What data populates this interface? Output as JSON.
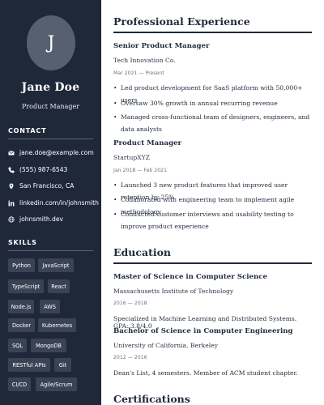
{
  "profile": {
    "initial": "J",
    "name": "Jane Doe",
    "role": "Product Manager"
  },
  "contact": {
    "title": "CONTACT",
    "items": [
      {
        "icon": "envelope-icon",
        "text": "jane.doe@example.com"
      },
      {
        "icon": "phone-icon",
        "text": "(555) 987-6543"
      },
      {
        "icon": "map-pin-icon",
        "text": "San Francisco, CA"
      },
      {
        "icon": "linkedin-icon",
        "text": "linkedin.com/in/johnsmith"
      },
      {
        "icon": "globe-icon",
        "text": "johnsmith.dev"
      }
    ]
  },
  "skills": {
    "title": "SKILLS",
    "items": [
      "Python",
      "JavaScript",
      "TypeScript",
      "React",
      "Node.js",
      "AWS",
      "Docker",
      "Kubernetes",
      "SQL",
      "MongoDB",
      "RESTful APIs",
      "Git",
      "CI/CD",
      "Agile/Scrum"
    ]
  },
  "experience": {
    "title": "Professional Experience",
    "jobs": [
      {
        "title": "Senior Product Manager",
        "company": "Tech Innovation Co.",
        "dates": "Mar 2021 — Present",
        "bullets": [
          "Led product development for SaaS platform with 50,000+ users",
          "Oversaw 30% growth in annual recurring revenue",
          "Managed cross-functional team of designers, engineers, and data analysts"
        ]
      },
      {
        "title": "Product Manager",
        "company": "StartupXYZ",
        "dates": "Jan 2018 — Feb 2021",
        "bullets": [
          "Launched 3 new product features that improved user retention by 25%",
          "Collaborated with engineering team to implement agile methodology",
          "Conducted customer interviews and usability testing to improve product experience"
        ]
      }
    ]
  },
  "education": {
    "title": "Education",
    "entries": [
      {
        "degree": "Master of Science in Computer Science",
        "school": "Massachusetts Institute of Technology",
        "dates": "2016 — 2018",
        "desc": "Specialized in Machine Learning and Distributed Systems. GPA: 3.8/4.0"
      },
      {
        "degree": "Bachelor of Science in Computer Engineering",
        "school": "University of California, Berkeley",
        "dates": "2012 — 2016",
        "desc": "Dean's List, 4 semesters. Member of ACM student chapter."
      }
    ]
  },
  "certifications": {
    "title": "Certifications"
  },
  "colors": {
    "sidebar": "#1f2839",
    "avatar": "#566070",
    "skill_chip": "#3a4354",
    "text": "#1f2a3c"
  }
}
